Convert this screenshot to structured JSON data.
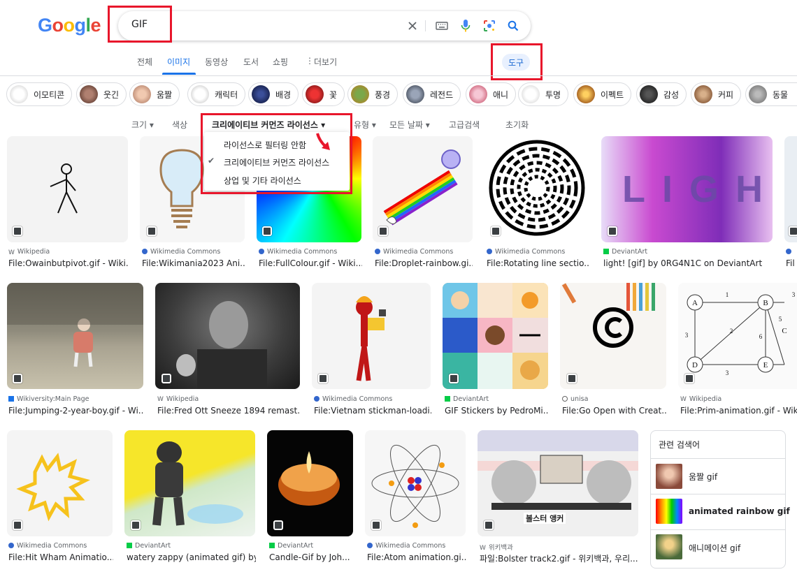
{
  "logo": "Google",
  "search": {
    "query": "GIF"
  },
  "nav": {
    "tabs": [
      "전체",
      "이미지",
      "동영상",
      "도서",
      "쇼핑"
    ],
    "more": "더보기",
    "tools": "도구"
  },
  "chips": [
    "이모티콘",
    "웃긴",
    "움짤",
    "캐릭터",
    "배경",
    "꽃",
    "풍경",
    "레전드",
    "애니",
    "투명",
    "이펙트",
    "감성",
    "커피",
    "동물"
  ],
  "filters": {
    "size": "크기",
    "color": "색상",
    "license": "크리에이티브 커먼즈 라이선스",
    "type": "유형",
    "date": "모든 날짜",
    "advanced": "고급검색",
    "reset": "초기화"
  },
  "license_menu": {
    "items": [
      "라이선스로 필터링 안함",
      "크리에이티브 커먼즈 라이선스",
      "상업 및 기타 라이선스"
    ],
    "selected_index": 1
  },
  "results": [
    {
      "source": "Wikipedia",
      "title": "File:Owainbutpivot.gif - Wiki..."
    },
    {
      "source": "Wikimedia Commons",
      "title": "File:Wikimania2023 Ani..."
    },
    {
      "source": "Wikimedia Commons",
      "title": "File:FullColour.gif - Wiki..."
    },
    {
      "source": "Wikimedia Commons",
      "title": "File:Droplet-rainbow.gi..."
    },
    {
      "source": "Wikimedia Commons",
      "title": "File:Rotating line sectio..."
    },
    {
      "source": "DeviantArt",
      "title": "light! [gif] by 0RG4N1C on DeviantArt"
    },
    {
      "source": "",
      "title": "Fil"
    },
    {
      "source": "Wikiversity:Main Page",
      "title": "File:Jumping-2-year-boy.gif - Wi..."
    },
    {
      "source": "Wikipedia",
      "title": "File:Fred Ott Sneeze 1894 remast..."
    },
    {
      "source": "Wikimedia Commons",
      "title": "File:Vietnam stickman-loadi..."
    },
    {
      "source": "DeviantArt",
      "title": "GIF Stickers by PedroMi..."
    },
    {
      "source": "unisa",
      "title": "File:Go Open with Creat..."
    },
    {
      "source": "Wikipedia",
      "title": "File:Prim-animation.gif - Wikipe"
    },
    {
      "source": "Wikimedia Commons",
      "title": "File:Hit Wham Animatio..."
    },
    {
      "source": "DeviantArt",
      "title": "watery zappy (animated gif) by..."
    },
    {
      "source": "DeviantArt",
      "title": "Candle-Gif by Joh..."
    },
    {
      "source": "Wikimedia Commons",
      "title": "File:Atom animation.gi..."
    },
    {
      "source": "위키백과",
      "title": "파일:Bolster track2.gif - 위키백과, 우리..."
    }
  ],
  "image_text": {
    "light": "LIGHT",
    "bolster": "볼스터 앵커",
    "graph_nodes": [
      "A",
      "B",
      "C",
      "D",
      "E"
    ],
    "graph_weights": [
      "1",
      "3",
      "2",
      "5",
      "6",
      "3",
      "3"
    ]
  },
  "related": {
    "title": "관련 검색어",
    "items": [
      "움짤 gif",
      "animated rainbow gif",
      "애니메이션 gif"
    ]
  },
  "colors": {
    "accent": "#1a73e8",
    "highlight": "#e8162b"
  }
}
